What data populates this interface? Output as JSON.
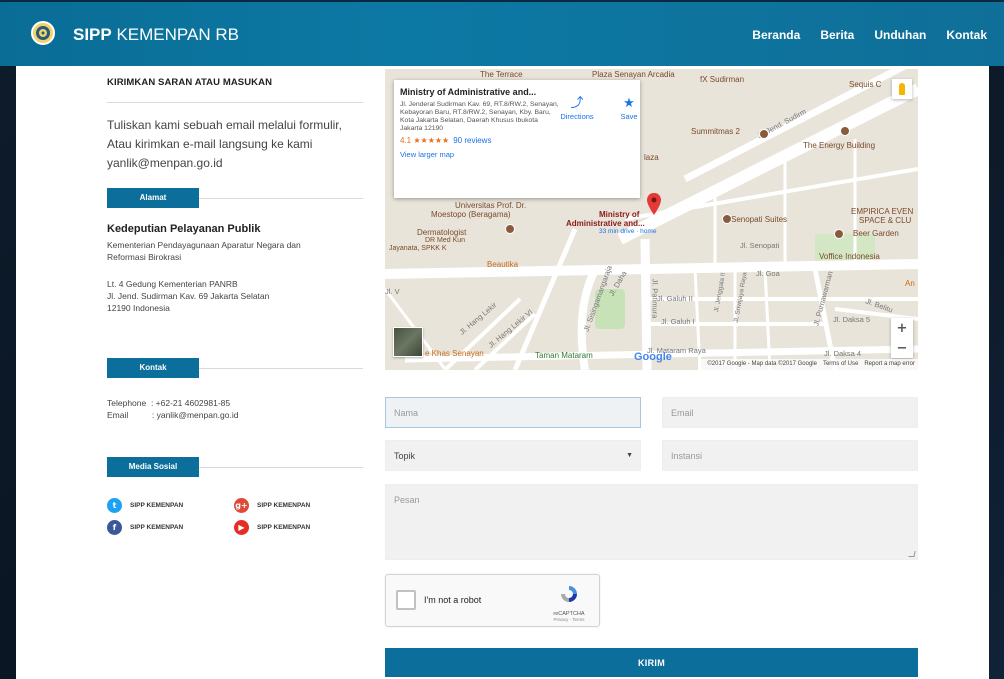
{
  "header": {
    "brand_bold": "SIPP",
    "brand_rest": " KEMENPAN RB",
    "nav": [
      "Beranda",
      "Berita",
      "Unduhan",
      "Kontak"
    ]
  },
  "left": {
    "title": "KIRIMKAN SARAN ATAU MASUKAN",
    "intro_lines": [
      "Tuliskan kami sebuah email melalui formulir,",
      "Atau kirimkan e-mail langsung ke kami",
      "yanlik@menpan.go.id"
    ],
    "alamat_tag": "Alamat",
    "org_title": "Kedeputian Pelayanan Publik",
    "org_lines": [
      "Kementerian Pendayagunaan Aparatur Negara dan",
      "Reformasi Birokrasi"
    ],
    "address_lines": [
      "Lt. 4 Gedung Kementerian PANRB",
      "Jl. Jend. Sudirman Kav. 69 Jakarta Selatan",
      "12190 Indonesia"
    ],
    "kontak_tag": "Kontak",
    "telephone": "Telephone  : +62-21 4602981-85",
    "email": "Email          : yanlik@menpan.go.id",
    "media_tag": "Media Sosial",
    "social": {
      "twitter": "SIPP KEMENPAN",
      "googleplus": "SIPP KEMENPAN",
      "facebook": "SIPP KEMENPAN",
      "youtube": "SIPP KEMENPAN"
    }
  },
  "map": {
    "card_name": "Ministry of Administrative and...",
    "card_addr": "Jl. Jenderal Sudirman Kav. 69, RT.8/RW.2, Senayan, Kebayoran Baru, RT.8/RW.2, Senayan, Kby. Baru, Kota Jakarta Selatan, Daerah Khusus Ibukota Jakarta 12190",
    "rating": "4.1 ★★★★★",
    "reviews": "90 reviews",
    "view_larger": "View larger map",
    "directions": "Directions",
    "save": "Save",
    "google": "Google",
    "attribution": "©2017 Google - Map data ©2017 Google",
    "terms": "Terms of Use",
    "report": "Report a map error",
    "labels": {
      "terrace": "The Terrace",
      "plaza_senayan": "Plaza Senayan Arcadia",
      "fx": "fX Sudirman",
      "sequis": "Sequis C",
      "summitmas": "Summitmas 2",
      "energy": "The Energy Building",
      "plaza": "laza",
      "univ1": "Universitas Prof. Dr.",
      "univ2": "Moestopo (Beragama)",
      "ministry1": "Ministry of",
      "ministry2": "Administrative and...",
      "drive": "33 min drive · home",
      "senopati": "Senopati Suites",
      "empirica1": "EMPIRICA EVEN",
      "empirica2": "SPACE & CLU",
      "beer": "Beer Garden",
      "voffice": "Voffice Indonesia",
      "dermato1": "Dermatologist",
      "dermato2": "DR Med Kun",
      "dermato3": "Jayanata, SPKK K",
      "beautika": "Beautika",
      "jl_senopati": "Jl. Senopati",
      "jl_goa": "Jl. Goa",
      "jl_galuh2": "Jl. Galuh II",
      "jl_galuh1": "Jl. Galuh I",
      "jl_patimura": "Jl. Patimura",
      "jl_daksa5": "Jl. Daksa 5",
      "jl_daksa4": "Jl. Daksa 4",
      "jl_hang_lekir": "Jl. Hang Lekir",
      "jl_hang_lekir6": "Jl. Hang Lekir VI",
      "jl_sisingamangaraja": "Jl. Sisingamangaraja",
      "jl_daha": "Jl. Daha",
      "jl_purnawarman": "Jl. Purnawarman",
      "jl_sudirman": "Jl. Jend. Sudirm",
      "jl_jenggala": "Jl. Jenggala II",
      "jl_sriwijaya": "Jl. Sriwijaya Raya",
      "jl_mataram": "Jl. Mataram Raya",
      "jl_belitung": "Jl. Belitu",
      "khas": "e Khas Senayan",
      "taman": "Taman Mataram",
      "an": "An",
      "v": "Jl. V"
    }
  },
  "form": {
    "nama_placeholder": "Nama",
    "email_placeholder": "Email",
    "topik_value": "Topik",
    "instansi_placeholder": "Instansi",
    "pesan_placeholder": "Pesan",
    "captcha_label": "I'm not a robot",
    "captcha_brand": "reCAPTCHA",
    "captcha_terms": "Privacy - Terms",
    "submit": "KIRIM"
  },
  "colors": {
    "header": "#0c79a4",
    "accent": "#0c6f9b",
    "twitter": "#1da1f2",
    "facebook": "#3b5998",
    "googleplus": "#dd4b39",
    "youtube": "#e52d27"
  }
}
